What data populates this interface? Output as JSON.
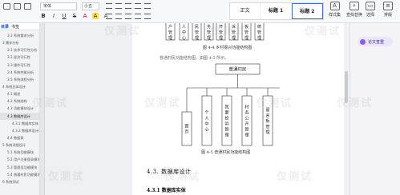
{
  "ribbon": {
    "font_name": "宋体",
    "font_size": "小五",
    "styles": [
      "正文",
      "标题 1",
      "标题 2"
    ],
    "style_selected": 2,
    "right_tools": [
      "样式集",
      "查找替换",
      "选择",
      "排版"
    ]
  },
  "nav": {
    "tabs": [
      "目录",
      "书签"
    ],
    "items": [
      {
        "text": "3.2 系统需求分析",
        "level": 2
      },
      {
        "text": "3 需求分析",
        "level": 1
      },
      {
        "text": "3.1 技术可行性分析",
        "level": 2
      },
      {
        "text": "3.2 经济可行性",
        "level": 2
      },
      {
        "text": "3.3 操作可行性",
        "level": 2
      },
      {
        "text": "3.4 系统性能分析",
        "level": 2
      },
      {
        "text": "3.5 系统流程分析",
        "level": 2
      },
      {
        "text": "4 系统总体设计",
        "level": 1
      },
      {
        "text": "4.1 概述",
        "level": 2
      },
      {
        "text": "4.2 系统结构",
        "level": 2
      },
      {
        "text": "4.3 功能模块设计",
        "level": 2
      },
      {
        "text": "4.3 数据库设计",
        "level": 2,
        "active": true
      },
      {
        "text": "4.3.1 数据库实体",
        "level": 3
      },
      {
        "text": "4.3.2 数据库设计表",
        "level": 3
      },
      {
        "text": "4.4 数据表",
        "level": 2
      },
      {
        "text": "5 系统详细设计",
        "level": 1
      },
      {
        "text": "5.1 系统功能模块",
        "level": 2
      },
      {
        "text": "5.2 用户注册登录模块",
        "level": 2
      },
      {
        "text": "5.3 管理员功能模块",
        "level": 2
      },
      {
        "text": "5.4 普通村民功能模块",
        "level": 2
      },
      {
        "text": "6 系统测试",
        "level": 1
      }
    ]
  },
  "document": {
    "top_boxes": [
      "用户管理",
      "个人中心",
      "普通村民管理",
      "村务管理",
      "村务公开管理",
      "村民投诉管理",
      "留言板管理",
      "系统管理"
    ],
    "caption1": "图 4-4 乡村振兴功能结构图",
    "body_line": "普通村民功能结构图，如图 4-5 所示。",
    "root_box": "普通村民",
    "child_boxes": [
      "首页",
      "个人中心",
      "我要投诉管理",
      "村务公开管理",
      "留言板管理"
    ],
    "caption2": "图 4-5 普通村民功能结构图",
    "heading3": "4.3. 数据库设计",
    "heading4": "4.3.1 数据库实体"
  },
  "right_panel": {
    "ai_label": "论文查重"
  },
  "watermark": "仅测试"
}
